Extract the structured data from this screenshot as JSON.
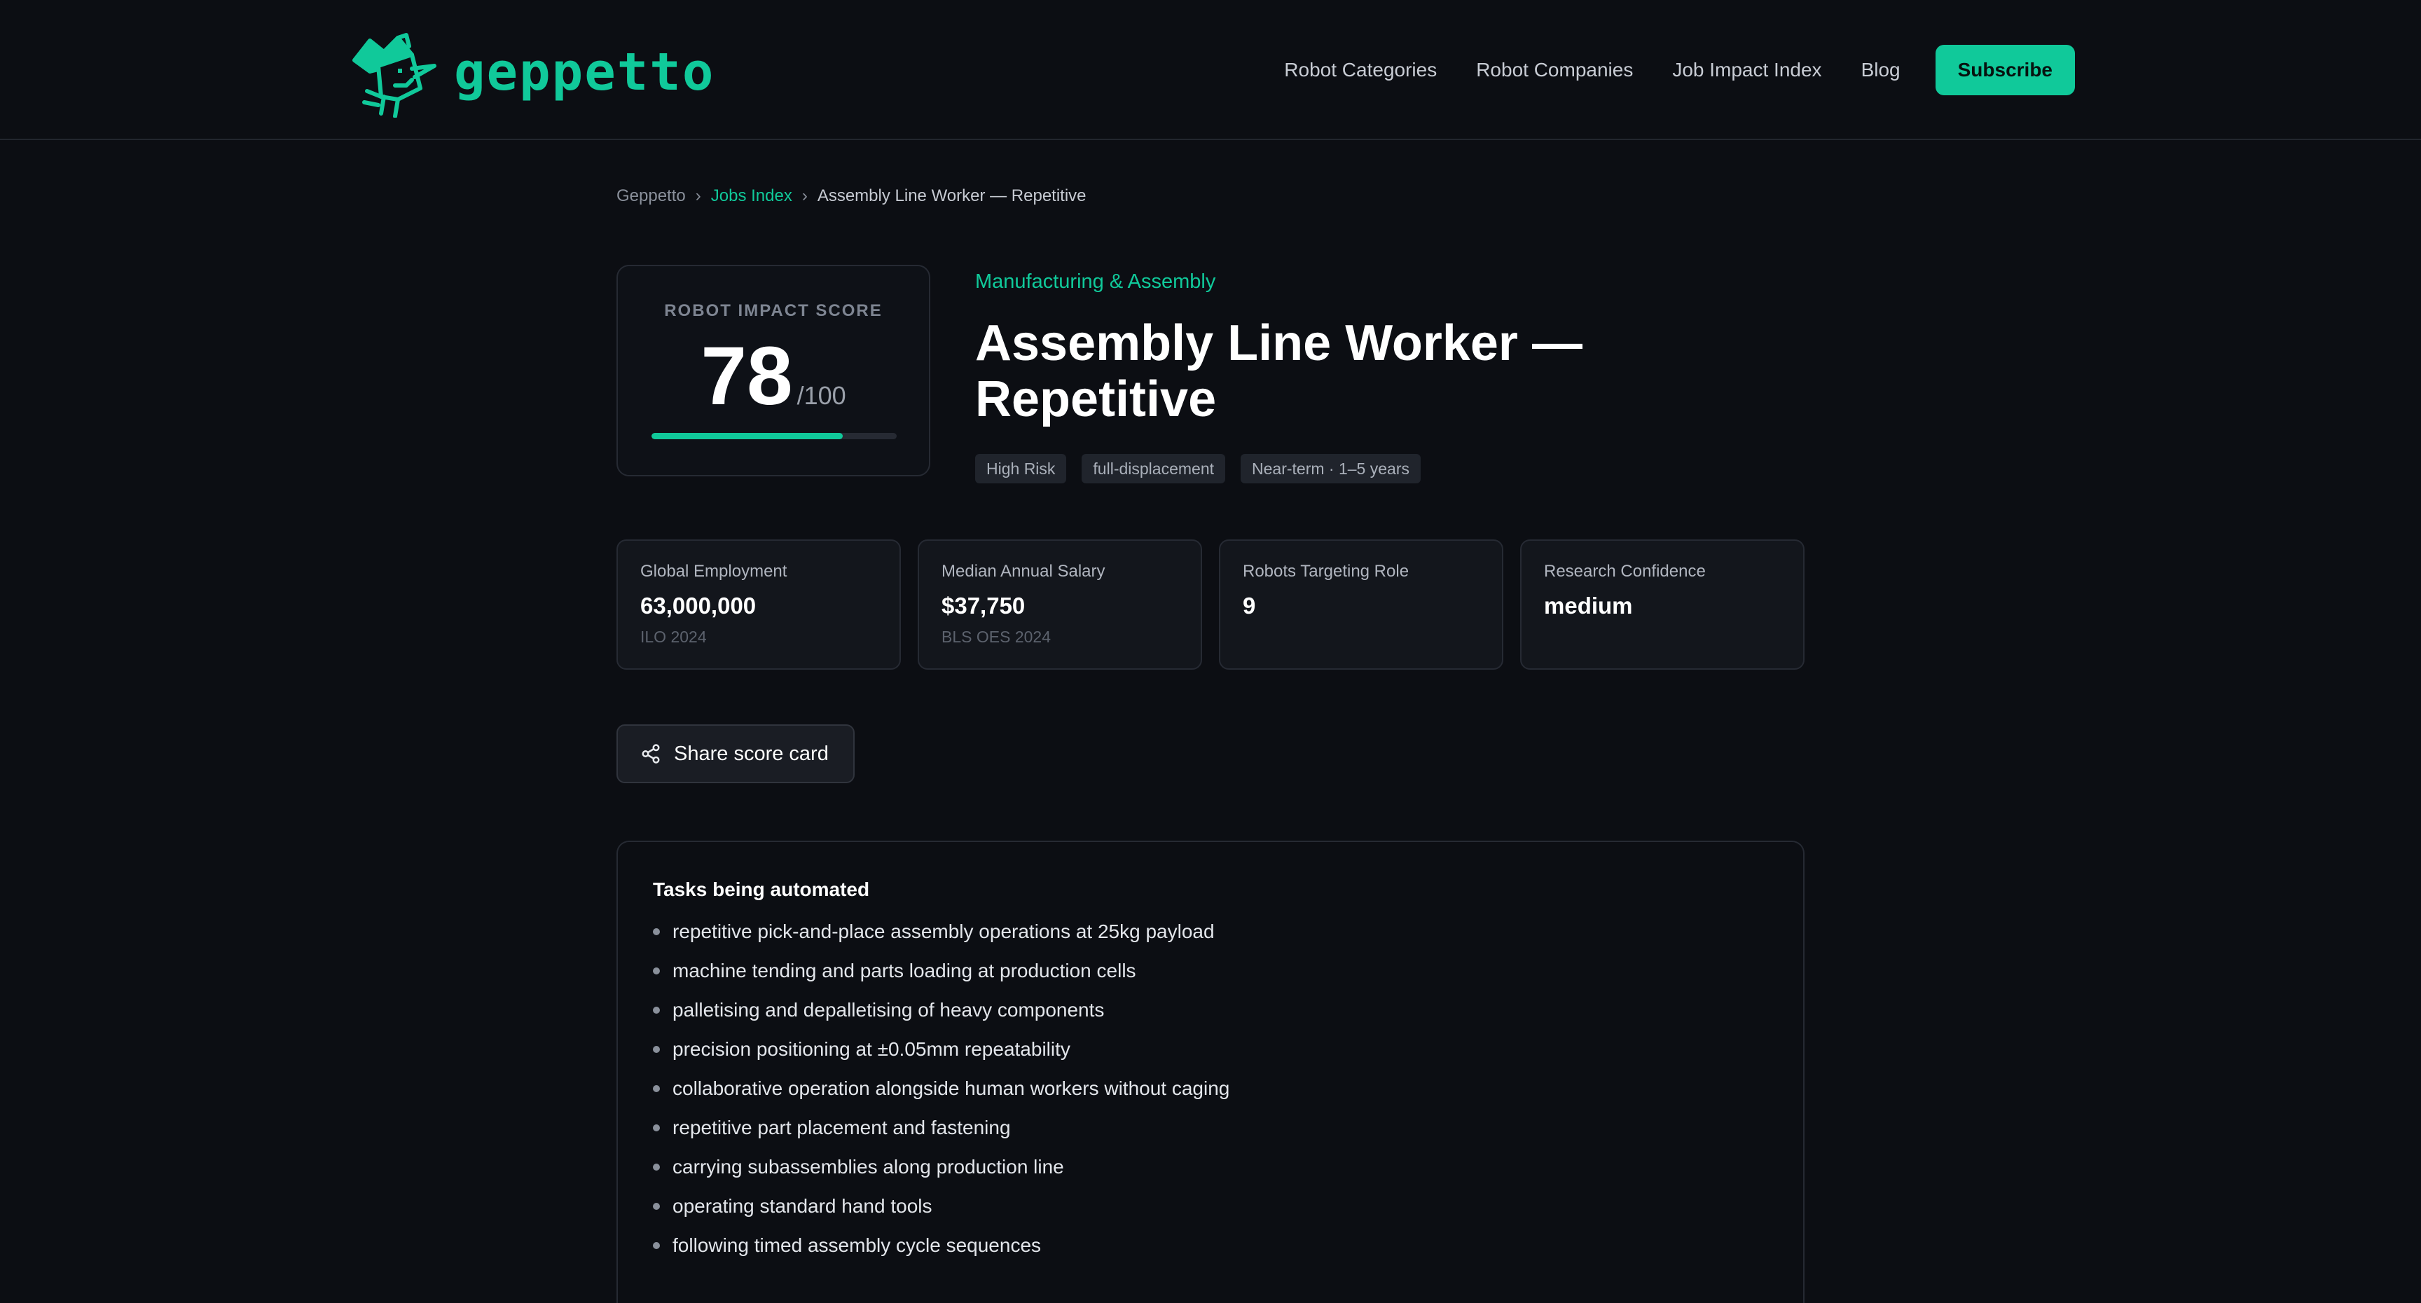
{
  "header": {
    "logo_text": "geppetto",
    "nav": [
      {
        "label": "Robot Categories"
      },
      {
        "label": "Robot Companies"
      },
      {
        "label": "Job Impact Index"
      },
      {
        "label": "Blog"
      }
    ],
    "subscribe_label": "Subscribe"
  },
  "breadcrumb": {
    "root": "Geppetto",
    "section": "Jobs Index",
    "current": "Assembly Line Worker — Repetitive",
    "separator": "›"
  },
  "score": {
    "label": "ROBOT IMPACT SCORE",
    "value": "78",
    "max": "/100",
    "fill_fraction": 0.78
  },
  "job": {
    "category": "Manufacturing & Assembly",
    "title": "Assembly Line Worker — Repetitive",
    "tags": [
      "High Risk",
      "full-displacement",
      "Near-term · 1–5 years"
    ]
  },
  "stats": [
    {
      "label": "Global Employment",
      "value": "63,000,000",
      "source": "ILO 2024"
    },
    {
      "label": "Median Annual Salary",
      "value": "$37,750",
      "source": "BLS OES 2024"
    },
    {
      "label": "Robots Targeting Role",
      "value": "9",
      "source": ""
    },
    {
      "label": "Research Confidence",
      "value": "medium",
      "source": ""
    }
  ],
  "share": {
    "label": "Share score card",
    "icon": "share-icon"
  },
  "tasks": {
    "title": "Tasks being automated",
    "items": [
      "repetitive pick-and-place assembly operations at 25kg payload",
      "machine tending and parts loading at production cells",
      "palletising and depalletising of heavy components",
      "precision positioning at ±0.05mm repeatability",
      "collaborative operation alongside human workers without caging",
      "repetitive part placement and fastening",
      "carrying subassemblies along production line",
      "operating standard hand tools",
      "following timed assembly cycle sequences"
    ]
  },
  "colors": {
    "background": "#0c0e13",
    "accent": "#10c99a",
    "card_border": "#262a33",
    "tag_bg": "#20242c"
  }
}
